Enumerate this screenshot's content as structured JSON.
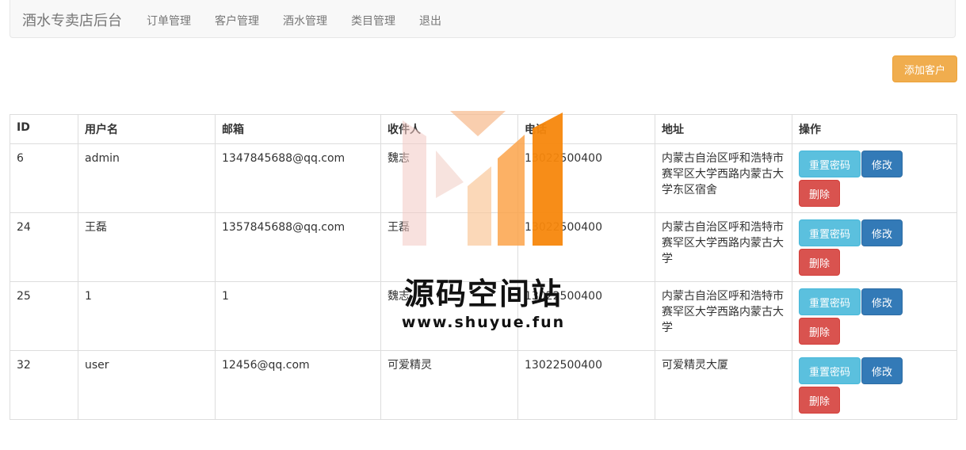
{
  "navbar": {
    "brand": "酒水专卖店后台",
    "items": [
      "订单管理",
      "客户管理",
      "酒水管理",
      "类目管理",
      "退出"
    ]
  },
  "add_button": "添加客户",
  "table": {
    "headers": [
      "ID",
      "用户名",
      "邮箱",
      "收件人",
      "电话",
      "地址",
      "操作"
    ],
    "rows": [
      {
        "id": "6",
        "username": "admin",
        "email": "1347845688@qq.com",
        "recipient": "魏志",
        "phone": "13022500400",
        "address": "内蒙古自治区呼和浩特市赛罕区大学西路内蒙古大学东区宿舍"
      },
      {
        "id": "24",
        "username": "王磊",
        "email": "1357845688@qq.com",
        "recipient": "王磊",
        "phone": "13022500400",
        "address": "内蒙古自治区呼和浩特市赛罕区大学西路内蒙古大学"
      },
      {
        "id": "25",
        "username": "1",
        "email": "1",
        "recipient": "魏志",
        "phone": "13022500400",
        "address": "内蒙古自治区呼和浩特市赛罕区大学西路内蒙古大学"
      },
      {
        "id": "32",
        "username": "user",
        "email": "12456@qq.com",
        "recipient": "可爱精灵",
        "phone": "13022500400",
        "address": "可爱精灵大厦"
      }
    ],
    "actions": {
      "reset": "重置密码",
      "edit": "修改",
      "delete": "删除"
    }
  },
  "watermark": {
    "title": "源码空间站",
    "url": "www.shuyue.fun"
  },
  "colors": {
    "warning": "#f0ad4e",
    "info": "#5bc0de",
    "primary": "#337ab7",
    "danger": "#d9534f"
  }
}
